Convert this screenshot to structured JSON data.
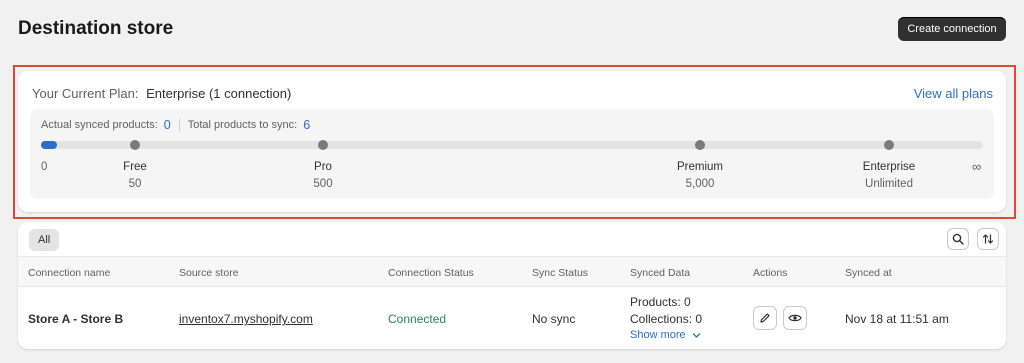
{
  "header": {
    "title": "Destination store",
    "create_label": "Create connection"
  },
  "plan": {
    "label": "Your Current Plan:",
    "value": "Enterprise (1 connection)",
    "view_all": "View all plans",
    "actual_label": "Actual synced products:",
    "actual_value": "0",
    "total_label": "Total products to sync:",
    "total_value": "6",
    "progress_fraction": 0.006,
    "zero_label": "0",
    "infinity_label": "∞",
    "tiers": [
      {
        "name": "Free",
        "limit": "50"
      },
      {
        "name": "Pro",
        "limit": "500"
      },
      {
        "name": "Premium",
        "limit": "5,000"
      },
      {
        "name": "Enterprise",
        "limit": "Unlimited"
      }
    ]
  },
  "table": {
    "tab_all": "All",
    "columns": [
      "Connection name",
      "Source store",
      "Connection Status",
      "Sync Status",
      "Synced Data",
      "Actions",
      "Synced at"
    ],
    "row": {
      "name": "Store A - Store B",
      "source": "inventox7.myshopify.com",
      "status": "Connected",
      "sync": "No sync",
      "products": "Products: 0",
      "collections": "Collections: 0",
      "show_more": "Show more",
      "synced_at": "Nov 18 at 11:51 am"
    }
  },
  "colors": {
    "accent": "#2c6ecb",
    "highlight": "#e0483a",
    "connected": "#29845a"
  },
  "icons": [
    "search-icon",
    "sort-icon",
    "edit-icon",
    "view-icon",
    "chevron-down-icon"
  ]
}
